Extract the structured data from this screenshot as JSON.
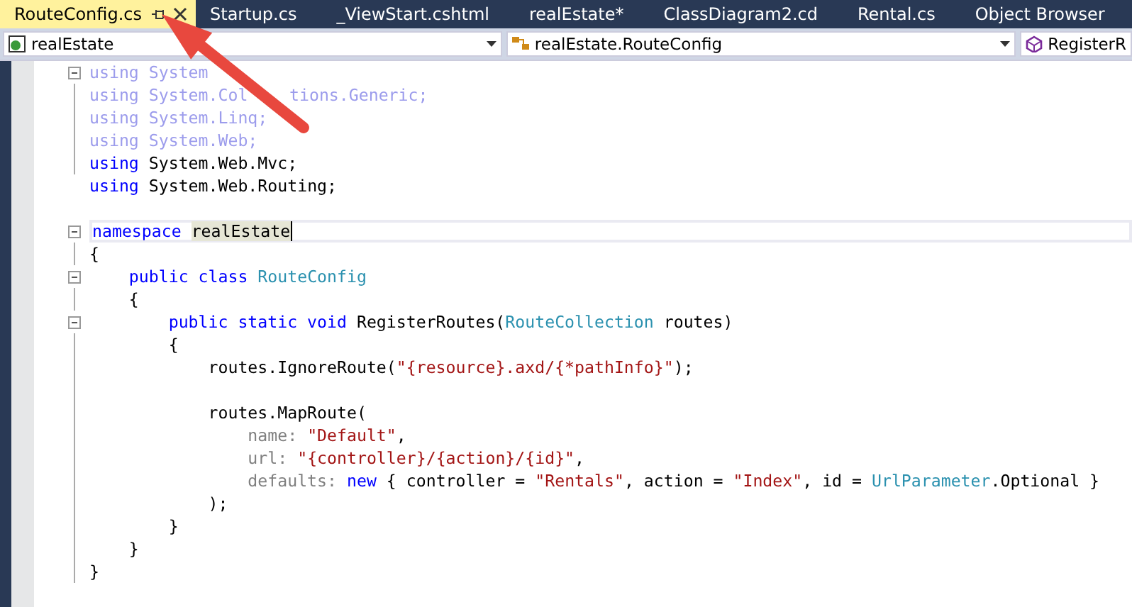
{
  "tabs": [
    {
      "label": "RouteConfig.cs",
      "selected": true,
      "pinnable": true
    },
    {
      "label": "Startup.cs",
      "selected": false
    },
    {
      "label": "_ViewStart.cshtml",
      "selected": false
    },
    {
      "label": "realEstate*",
      "selected": false
    },
    {
      "label": "ClassDiagram2.cd",
      "selected": false
    },
    {
      "label": "Rental.cs",
      "selected": false
    },
    {
      "label": "Object Browser",
      "selected": false
    }
  ],
  "navigation_bar": [
    {
      "kind": "project",
      "text": "realEstate"
    },
    {
      "kind": "class",
      "text": "realEstate.RouteConfig"
    },
    {
      "kind": "member",
      "text": "RegisterR"
    }
  ],
  "code_lines": [
    {
      "collapsible": true,
      "segments": [
        {
          "kind": "unused",
          "text": "using System"
        }
      ]
    },
    {
      "segments": [
        {
          "kind": "unused",
          "text": "using System.Col"
        },
        {
          "kind": "unused",
          "text": "tions.Generic;",
          "covered_before": true
        }
      ]
    },
    {
      "segments": [
        {
          "kind": "unused",
          "text": "using System.Linq;"
        }
      ]
    },
    {
      "segments": [
        {
          "kind": "unused",
          "text": "using System.Web;"
        }
      ]
    },
    {
      "segments": [
        {
          "kind": "keyword",
          "text": "using"
        },
        {
          "kind": "plain",
          "text": " System.Web.Mvc;"
        }
      ]
    },
    {
      "gap_after": true,
      "segments": [
        {
          "kind": "keyword",
          "text": "using"
        },
        {
          "kind": "plain",
          "text": " System.Web.Routing;"
        }
      ]
    },
    {
      "collapsible": true,
      "current": true,
      "segments": [
        {
          "kind": "keyword",
          "text": "namespace "
        },
        {
          "kind": "highlight",
          "text": "realEstate"
        }
      ]
    },
    {
      "segments": [
        {
          "kind": "plain",
          "text": "{"
        }
      ]
    },
    {
      "collapsible": true,
      "segments": [
        {
          "kind": "keyword",
          "text": "    public class "
        },
        {
          "kind": "type",
          "text": "RouteConfig"
        }
      ]
    },
    {
      "segments": [
        {
          "kind": "plain",
          "text": "    {"
        }
      ]
    },
    {
      "collapsible": true,
      "segments": [
        {
          "kind": "keyword",
          "text": "        public static void"
        },
        {
          "kind": "plain",
          "text": " RegisterRoutes("
        },
        {
          "kind": "type",
          "text": "RouteCollection"
        },
        {
          "kind": "plain",
          "text": " routes)"
        }
      ]
    },
    {
      "segments": [
        {
          "kind": "plain",
          "text": "        {"
        }
      ]
    },
    {
      "gap_after": true,
      "segments": [
        {
          "kind": "plain",
          "text": "            routes.IgnoreRoute("
        },
        {
          "kind": "string",
          "text": "\"{resource}.axd/{*pathInfo}\""
        },
        {
          "kind": "plain",
          "text": ");"
        }
      ]
    },
    {
      "segments": [
        {
          "kind": "plain",
          "text": "            routes.MapRoute("
        }
      ]
    },
    {
      "segments": [
        {
          "kind": "param",
          "text": "                name: "
        },
        {
          "kind": "string",
          "text": "\"Default\""
        },
        {
          "kind": "plain",
          "text": ","
        }
      ]
    },
    {
      "segments": [
        {
          "kind": "param",
          "text": "                url: "
        },
        {
          "kind": "string",
          "text": "\"{controller}/{action}/{id}\""
        },
        {
          "kind": "plain",
          "text": ","
        }
      ]
    },
    {
      "segments": [
        {
          "kind": "param",
          "text": "                defaults: "
        },
        {
          "kind": "keyword",
          "text": "new"
        },
        {
          "kind": "plain",
          "text": " { controller = "
        },
        {
          "kind": "string",
          "text": "\"Rentals\""
        },
        {
          "kind": "plain",
          "text": ", action = "
        },
        {
          "kind": "string",
          "text": "\"Index\""
        },
        {
          "kind": "plain",
          "text": ", id = "
        },
        {
          "kind": "type",
          "text": "UrlParameter"
        },
        {
          "kind": "plain",
          "text": ".Optional }"
        }
      ]
    },
    {
      "segments": [
        {
          "kind": "plain",
          "text": "            );"
        }
      ]
    },
    {
      "segments": [
        {
          "kind": "plain",
          "text": "        }"
        }
      ]
    },
    {
      "segments": [
        {
          "kind": "plain",
          "text": "    }"
        }
      ]
    },
    {
      "segments": [
        {
          "kind": "plain",
          "text": "}"
        }
      ]
    }
  ]
}
